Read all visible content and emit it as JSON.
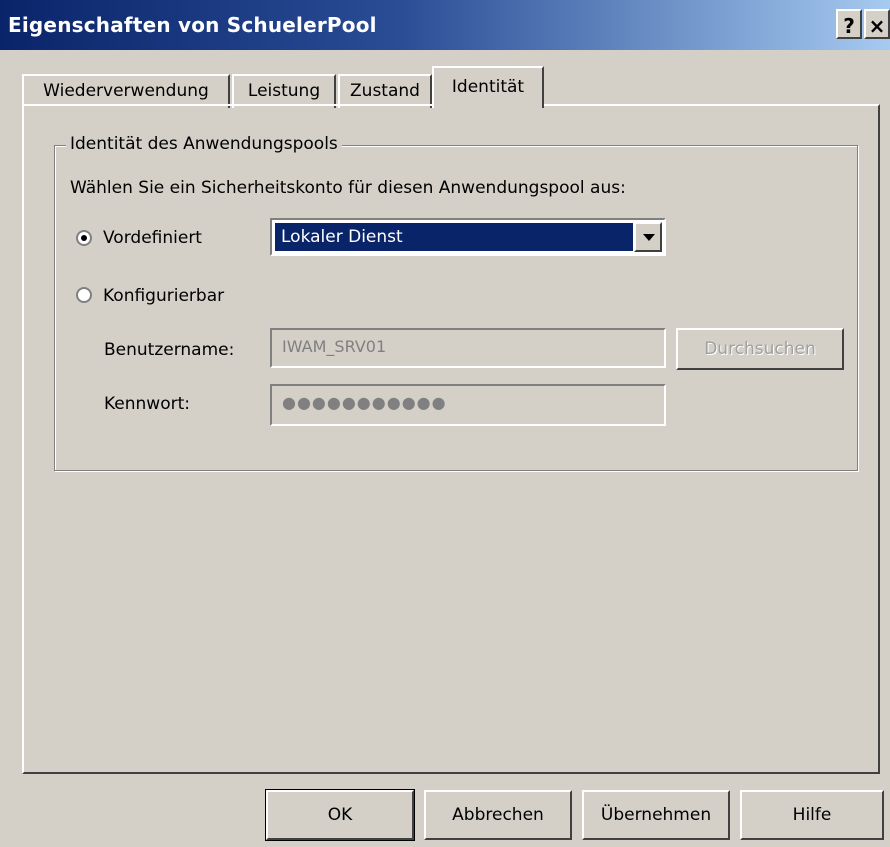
{
  "window": {
    "title": "Eigenschaften von SchuelerPool"
  },
  "titlebar": {
    "help": "?",
    "close": "×"
  },
  "tabs": [
    {
      "label": "Wiederverwendung"
    },
    {
      "label": "Leistung"
    },
    {
      "label": "Zustand"
    },
    {
      "label": "Identität"
    }
  ],
  "group": {
    "legend": "Identität des Anwendungspools",
    "prompt": "Wählen Sie ein Sicherheitskonto für diesen Anwendungspool aus:",
    "radios": {
      "predefined": "Vordefiniert",
      "configurable": "Konfigurierbar"
    },
    "combo_value": "Lokaler Dienst",
    "username_label": "Benutzername:",
    "username_value": "IWAM_SRV01",
    "password_label": "Kennwort:",
    "password_value": "●●●●●●●●●●●",
    "browse_label": "Durchsuchen"
  },
  "buttons": {
    "ok": "OK",
    "cancel": "Abbrechen",
    "apply": "Übernehmen",
    "help": "Hilfe"
  }
}
